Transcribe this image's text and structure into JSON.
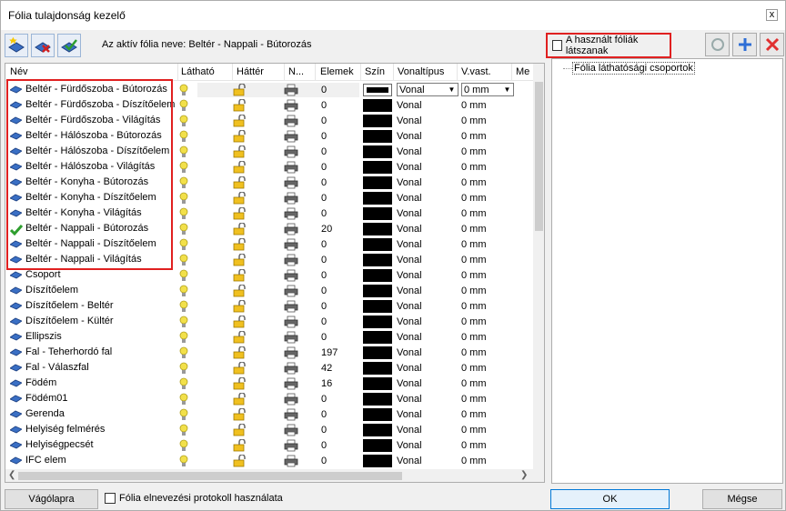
{
  "window": {
    "title": "Fólia tulajdonság kezelő",
    "close": "x"
  },
  "toolbar": {
    "active_layer": "Az aktív fólia neve: Beltér - Nappali - Bútorozás",
    "used_layers_label": "A használt fóliák látszanak",
    "used_layers_checked": false
  },
  "grid": {
    "headers": [
      "Név",
      "Látható",
      "Háttér",
      "N...",
      "Elemek",
      "Szín",
      "Vonaltípus",
      "V.vast.",
      "Me"
    ],
    "active_line_type": "Vonal",
    "active_line_width": "0 mm",
    "rows": [
      {
        "name": "Beltér - Fürdőszoba - Bútorozás",
        "elems": "0",
        "linetype": "Vonal",
        "width": "0 mm",
        "active": false
      },
      {
        "name": "Beltér - Fürdőszoba - Díszítőelem",
        "elems": "0",
        "linetype": "Vonal",
        "width": "0 mm"
      },
      {
        "name": "Beltér - Fürdőszoba - Világítás",
        "elems": "0",
        "linetype": "Vonal",
        "width": "0 mm"
      },
      {
        "name": "Beltér - Hálószoba - Bútorozás",
        "elems": "0",
        "linetype": "Vonal",
        "width": "0 mm"
      },
      {
        "name": "Beltér - Hálószoba - Díszítőelem",
        "elems": "0",
        "linetype": "Vonal",
        "width": "0 mm"
      },
      {
        "name": "Beltér - Hálószoba - Világítás",
        "elems": "0",
        "linetype": "Vonal",
        "width": "0 mm"
      },
      {
        "name": "Beltér - Konyha - Bútorozás",
        "elems": "0",
        "linetype": "Vonal",
        "width": "0 mm"
      },
      {
        "name": "Beltér - Konyha - Díszítőelem",
        "elems": "0",
        "linetype": "Vonal",
        "width": "0 mm"
      },
      {
        "name": "Beltér - Konyha - Világítás",
        "elems": "0",
        "linetype": "Vonal",
        "width": "0 mm"
      },
      {
        "name": "Beltér - Nappali - Bútorozás",
        "elems": "20",
        "linetype": "Vonal",
        "width": "0 mm",
        "current": true
      },
      {
        "name": "Beltér - Nappali - Díszítőelem",
        "elems": "0",
        "linetype": "Vonal",
        "width": "0 mm"
      },
      {
        "name": "Beltér - Nappali - Világítás",
        "elems": "0",
        "linetype": "Vonal",
        "width": "0 mm"
      },
      {
        "name": "Csoport",
        "elems": "0",
        "linetype": "Vonal",
        "width": "0 mm"
      },
      {
        "name": "Díszítőelem",
        "elems": "0",
        "linetype": "Vonal",
        "width": "0 mm"
      },
      {
        "name": "Díszítőelem - Beltér",
        "elems": "0",
        "linetype": "Vonal",
        "width": "0 mm"
      },
      {
        "name": "Díszítőelem - Kültér",
        "elems": "0",
        "linetype": "Vonal",
        "width": "0 mm"
      },
      {
        "name": "Ellipszis",
        "elems": "0",
        "linetype": "Vonal",
        "width": "0 mm"
      },
      {
        "name": "Fal - Teherhordó fal",
        "elems": "197",
        "linetype": "Vonal",
        "width": "0 mm"
      },
      {
        "name": "Fal - Válaszfal",
        "elems": "42",
        "linetype": "Vonal",
        "width": "0 mm"
      },
      {
        "name": "Födém",
        "elems": "16",
        "linetype": "Vonal",
        "width": "0 mm"
      },
      {
        "name": "Födém01",
        "elems": "0",
        "linetype": "Vonal",
        "width": "0 mm"
      },
      {
        "name": "Gerenda",
        "elems": "0",
        "linetype": "Vonal",
        "width": "0 mm"
      },
      {
        "name": "Helyiség felmérés",
        "elems": "0",
        "linetype": "Vonal",
        "width": "0 mm"
      },
      {
        "name": "Helyiségpecsét",
        "elems": "0",
        "linetype": "Vonal",
        "width": "0 mm"
      },
      {
        "name": "IFC elem",
        "elems": "0",
        "linetype": "Vonal",
        "width": "0 mm"
      }
    ]
  },
  "panel": {
    "tree_item": "Fólia láthatósági csoportok"
  },
  "bottom": {
    "clipboard": "Vágólapra",
    "protocol": "Fólia elnevezési protokoll használata",
    "ok": "OK",
    "cancel": "Mégse"
  },
  "colors": {
    "highlight": "#e02020",
    "layer_icon": "#3a6fc4",
    "current_check": "#2e9e2e",
    "bulb": "#f2e04a"
  }
}
